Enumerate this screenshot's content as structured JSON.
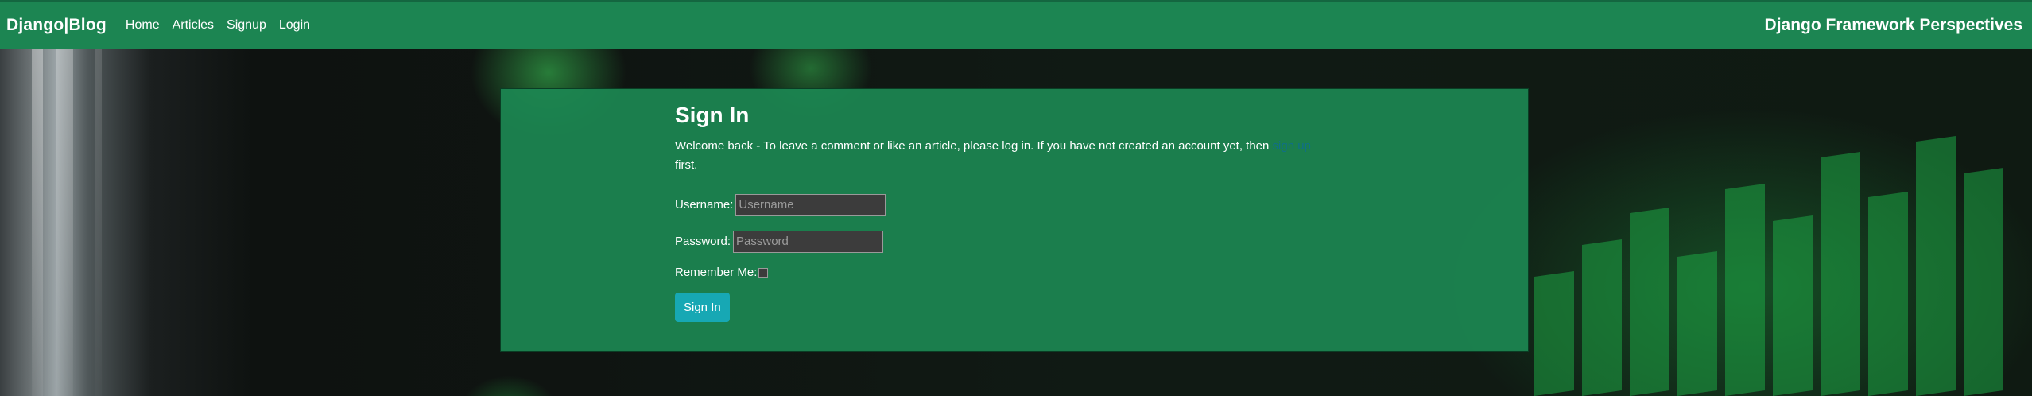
{
  "navbar": {
    "brand": "Django|Blog",
    "links": [
      "Home",
      "Articles",
      "Signup",
      "Login"
    ],
    "site_title": "Django Framework Perspectives",
    "background": "#1c8552"
  },
  "signin": {
    "title": "Sign In",
    "intro_before": "Welcome back - To leave a comment or like an article, please log in. If you have not created an account yet, then ",
    "intro_link": "sign up",
    "intro_after": "first.",
    "username_label": "Username:",
    "username_placeholder": "Username",
    "password_label": "Password:",
    "password_placeholder": "Password",
    "remember_label": "Remember Me:",
    "submit_label": "Sign In",
    "button_color": "#17a8b4"
  }
}
